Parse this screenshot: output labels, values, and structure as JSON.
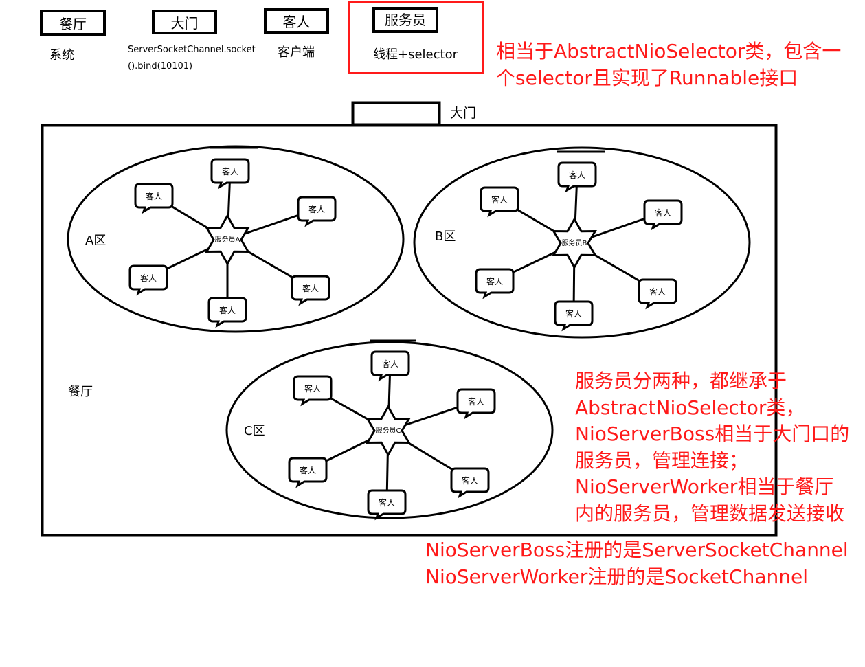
{
  "legend": {
    "restaurant": {
      "box_label": "餐厅",
      "caption": "系统"
    },
    "door": {
      "box_label": "大门",
      "caption_line1": "ServerSocketChannel.socket",
      "caption_line2": "().bind(10101)"
    },
    "guest": {
      "box_label": "客人",
      "caption": "客户端"
    },
    "waiter": {
      "box_label": "服务员",
      "caption": "线程+selector"
    }
  },
  "notes": {
    "selector_note_line1": "相当于AbstractNioSelector类，包含一",
    "selector_note_line2": "个selector且实现了Runnable接口",
    "waiter_types": [
      "服务员分两种，都继承于",
      "AbstractNioSelector类，",
      "NioServerBoss相当于大门口的",
      "服务员，管理连接；",
      "NioServerWorker相当于餐厅",
      "内的服务员，管理数据发送接收"
    ],
    "register_line1": "NioServerBoss注册的是ServerSocketChannel",
    "register_line2": "NioServerWorker注册的是SocketChannel"
  },
  "diagram": {
    "door_label": "大门",
    "restaurant_label": "餐厅",
    "guest_label": "客人",
    "zones": [
      {
        "id": "a",
        "zone_label": "A区",
        "waiter_label": "服务员A"
      },
      {
        "id": "b",
        "zone_label": "B区",
        "waiter_label": "服务员B"
      },
      {
        "id": "c",
        "zone_label": "C区",
        "waiter_label": "服务员C"
      }
    ]
  },
  "colors": {
    "note_red": "#ff1a1a",
    "line": "#000000"
  }
}
